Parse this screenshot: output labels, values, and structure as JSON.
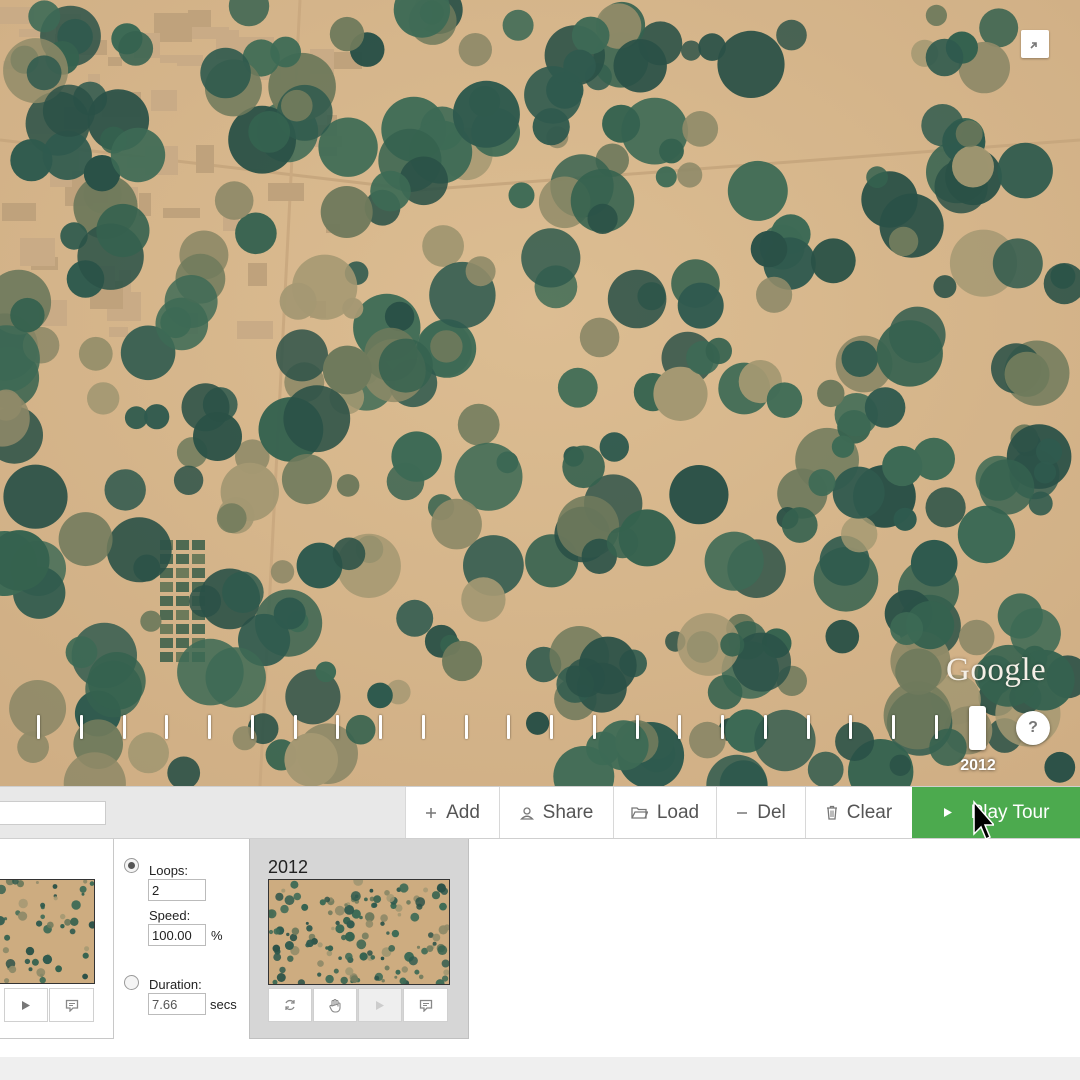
{
  "map": {
    "attribution": "Google",
    "fullscreen_icon": "collapse-icon",
    "help_label": "?",
    "timeline": {
      "tick_count": 23,
      "selected_year": "2012"
    }
  },
  "toolbar": {
    "tour_name_value": "",
    "buttons": [
      {
        "label": "Add",
        "icon": "plus-icon"
      },
      {
        "label": "Share",
        "icon": "share-icon"
      },
      {
        "label": "Load",
        "icon": "folder-icon"
      },
      {
        "label": "Del",
        "icon": "minus-icon"
      },
      {
        "label": "Clear",
        "icon": "trash-icon"
      },
      {
        "label": "Play Tour",
        "icon": "play-icon"
      }
    ],
    "colors": {
      "play_tour": "#4caa4e"
    }
  },
  "tour": {
    "settings": {
      "loops_label": "Loops:",
      "loops_value": "2",
      "speed_label": "Speed:",
      "speed_value": "100.00",
      "speed_unit": "%",
      "duration_label": "Duration:",
      "duration_value": "7.66",
      "duration_unit": "secs",
      "selected_mode": "loops"
    },
    "keyframes": [
      {
        "year": "",
        "buttons": [
          "play-icon",
          "comment-icon"
        ]
      },
      {
        "year": "2012",
        "buttons": [
          "loop-icon",
          "hand-icon",
          "play-icon",
          "comment-icon"
        ]
      }
    ]
  }
}
